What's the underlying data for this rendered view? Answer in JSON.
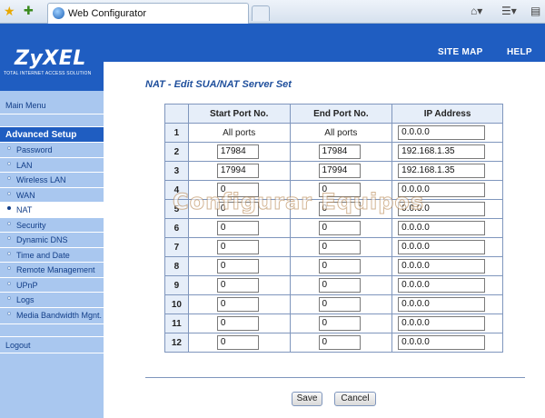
{
  "browser": {
    "tab_title": "Web Configurator",
    "icons": [
      "favorites-star-icon",
      "add-favorites-icon",
      "home-icon",
      "feeds-icon"
    ]
  },
  "header": {
    "logo": "ZyXEL",
    "tagline": "TOTAL INTERNET ACCESS SOLUTION",
    "site_map": "SITE MAP",
    "help": "HELP"
  },
  "sidebar": {
    "main_menu": "Main Menu",
    "advanced_setup": "Advanced Setup",
    "items": [
      "Password",
      "LAN",
      "Wireless LAN",
      "WAN",
      "NAT",
      "Security",
      "Dynamic DNS",
      "Time and Date",
      "Remote Management",
      "UPnP",
      "Logs",
      "Media Bandwidth Mgnt."
    ],
    "active": "NAT",
    "logout": "Logout"
  },
  "page": {
    "title": "NAT - Edit SUA/NAT Server Set",
    "columns": [
      "",
      "Start Port No.",
      "End Port No.",
      "IP Address"
    ],
    "rows": [
      {
        "n": "1",
        "start": "All ports",
        "end": "All ports",
        "ip": "0.0.0.0"
      },
      {
        "n": "2",
        "start": "17984",
        "end": "17984",
        "ip": "192.168.1.35"
      },
      {
        "n": "3",
        "start": "17994",
        "end": "17994",
        "ip": "192.168.1.35"
      },
      {
        "n": "4",
        "start": "0",
        "end": "0",
        "ip": "0.0.0.0"
      },
      {
        "n": "5",
        "start": "0",
        "end": "0",
        "ip": "0.0.0.0"
      },
      {
        "n": "6",
        "start": "0",
        "end": "0",
        "ip": "0.0.0.0"
      },
      {
        "n": "7",
        "start": "0",
        "end": "0",
        "ip": "0.0.0.0"
      },
      {
        "n": "8",
        "start": "0",
        "end": "0",
        "ip": "0.0.0.0"
      },
      {
        "n": "9",
        "start": "0",
        "end": "0",
        "ip": "0.0.0.0"
      },
      {
        "n": "10",
        "start": "0",
        "end": "0",
        "ip": "0.0.0.0"
      },
      {
        "n": "11",
        "start": "0",
        "end": "0",
        "ip": "0.0.0.0"
      },
      {
        "n": "12",
        "start": "0",
        "end": "0",
        "ip": "0.0.0.0"
      }
    ],
    "save_label": "Save",
    "cancel_label": "Cancel"
  },
  "watermark": "Configurar Equipos"
}
